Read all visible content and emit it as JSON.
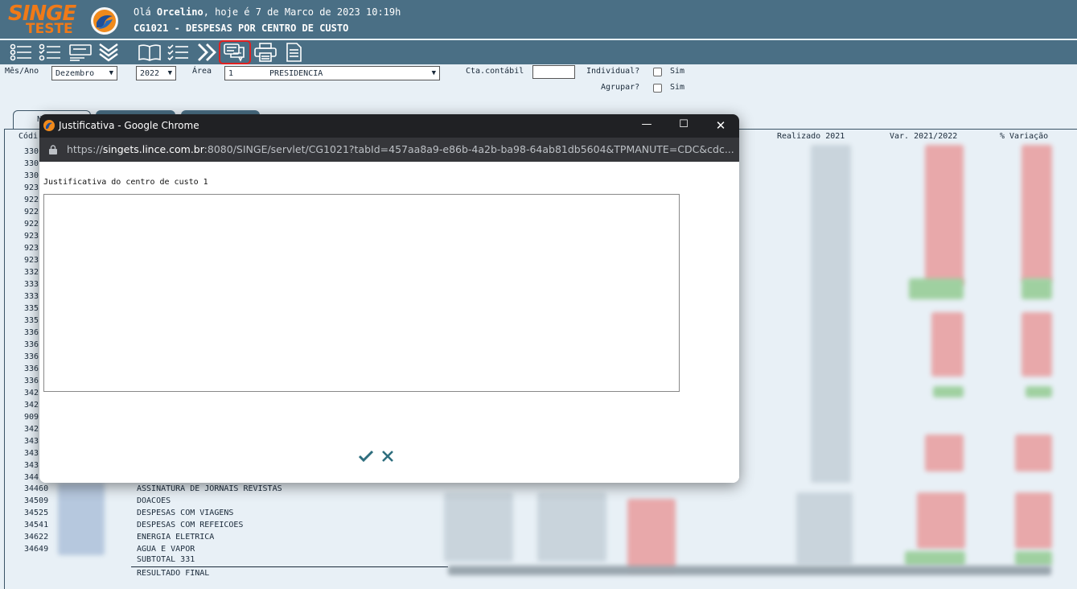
{
  "header": {
    "logo_line1": "SINGE",
    "logo_line2": "TESTE",
    "greeting_prefix": "Olá ",
    "user_name": "Orcelino",
    "greeting_suffix": ", hoje é 7 de Marco de 2023 10:19h",
    "program_title": "CG1021 - DESPESAS POR CENTRO DE CUSTO"
  },
  "toolbar": {
    "icons": [
      "list-icon",
      "checklist-icon",
      "report-icon",
      "expand-all-icon",
      "book-icon",
      "tasks-icon",
      "next-icon",
      "justification-icon",
      "print-icon",
      "document-icon"
    ],
    "selected": "justification-icon"
  },
  "filters": {
    "month_year_label": "Mês/Ano",
    "month_value": "Dezembro",
    "year_value": "2022",
    "area_label": "Área",
    "area_code": "1",
    "area_name": "PRESIDENCIA",
    "account_label": "Cta.contábil",
    "account_value": "",
    "individual_label": "Individual?",
    "individual_option": "Sim",
    "group_label": "Agrupar?",
    "group_option": "Sim"
  },
  "table": {
    "headers": {
      "code": "Códi",
      "realized": "Realizado 2021",
      "variance": "Var. 2021/2022",
      "pct": "% Variação"
    },
    "hidden_codes": [
      "330",
      "330",
      "330",
      "923",
      "922",
      "922",
      "922",
      "923",
      "923",
      "923",
      "332",
      "333",
      "333",
      "335",
      "335",
      "336",
      "336",
      "336",
      "336",
      "336",
      "342",
      "342",
      "909",
      "342",
      "343",
      "343",
      "343",
      "344"
    ],
    "rows": [
      {
        "code": "34460",
        "description": "ASSINATURA DE JORNAIS REVISTAS"
      },
      {
        "code": "34509",
        "description": "DOACOES"
      },
      {
        "code": "34525",
        "description": "DESPESAS COM VIAGENS"
      },
      {
        "code": "34541",
        "description": "DESPESAS COM REFEICOES"
      },
      {
        "code": "34622",
        "description": "ENERGIA ELETRICA"
      },
      {
        "code": "34649",
        "description": "AGUA E VAPOR"
      }
    ],
    "subtotal_label": "SUBTOTAL 331",
    "final_label": "RESULTADO FINAL",
    "tab_letter": "N"
  },
  "popup": {
    "window_title": "Justificativa - Google Chrome",
    "url_prefix": "https://",
    "url_host": "singets.lince.com.br",
    "url_rest": ":8080/SINGE/servlet/CG1021?tabId=457aa8a9-e86b-4a2b-ba98-64ab81db5604&TPMANUTE=CDC&cdc...",
    "label": "Justificativa do centro de custo 1",
    "text_value": "",
    "colors": {
      "titlebar": "#202124",
      "urlbar": "#35363a",
      "confirm": "#2e6e7e"
    }
  }
}
